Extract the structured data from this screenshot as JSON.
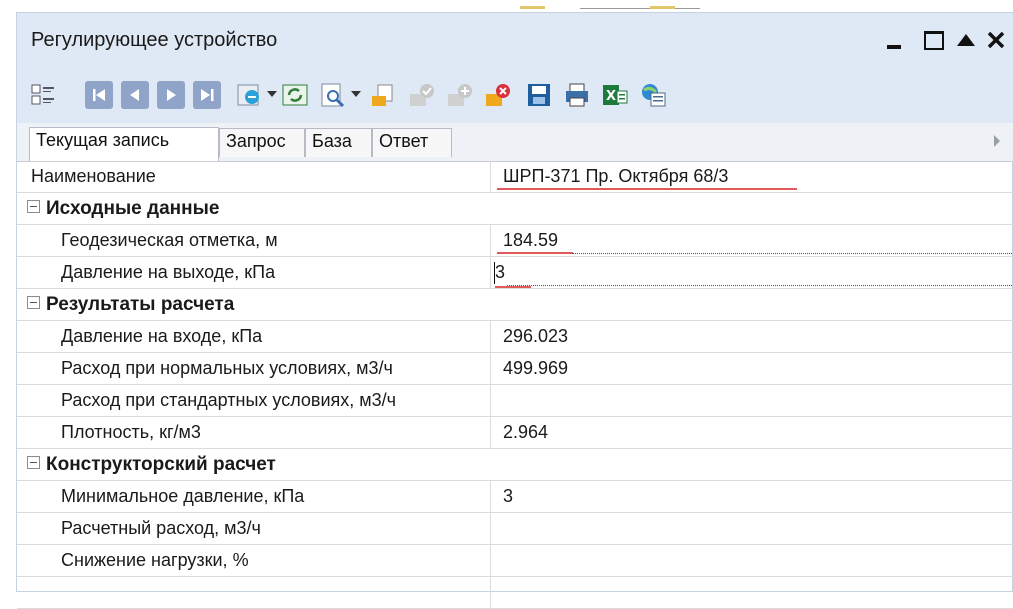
{
  "window": {
    "title": "Регулирующее устройство",
    "controls": [
      "minimize-icon",
      "maximize-icon",
      "collapse-up-icon",
      "close-icon"
    ]
  },
  "toolbar": {
    "icons": [
      "grid-view-icon",
      "first-record-icon",
      "prev-record-icon",
      "next-record-icon",
      "last-record-icon",
      "refresh-icon",
      "sync-icon",
      "preview-icon",
      "new-record-icon",
      "approve-record-icon",
      "add-record-icon",
      "delete-record-icon",
      "save-icon",
      "print-icon",
      "excel-export-icon",
      "map-export-icon"
    ]
  },
  "tabs": [
    "Текущая запись",
    "Запрос",
    "База",
    "Ответ"
  ],
  "active_tab": "Текущая запись",
  "grid": {
    "name_row": {
      "label": "Наименование",
      "value": "ШРП-371 Пр. Октября 68/3"
    },
    "sections": [
      {
        "title": "Исходные данные",
        "rows": [
          {
            "label": "Геодезическая отметка, м",
            "value": "184.59"
          },
          {
            "label": "Давление на выходе, кПа",
            "value": "3"
          }
        ]
      },
      {
        "title": "Результаты расчета",
        "rows": [
          {
            "label": "Давление на входе, кПа",
            "value": "296.023"
          },
          {
            "label": "Расход при нормальных условиях, м3/ч",
            "value": "499.969"
          },
          {
            "label": "Расход при стандартных условиях, м3/ч",
            "value": ""
          },
          {
            "label": "Плотность, кг/м3",
            "value": "2.964"
          }
        ]
      },
      {
        "title": "Конструкторский расчет",
        "rows": [
          {
            "label": "Минимальное давление,  кПа",
            "value": "3"
          },
          {
            "label": "Расчетный расход, м3/ч",
            "value": ""
          },
          {
            "label": "Снижение нагрузки, %",
            "value": ""
          }
        ]
      }
    ]
  },
  "colors": {
    "titlebar": "#dfe9f5",
    "grid_line": "#dcdcdc",
    "red_marker": "#e05a5a"
  }
}
